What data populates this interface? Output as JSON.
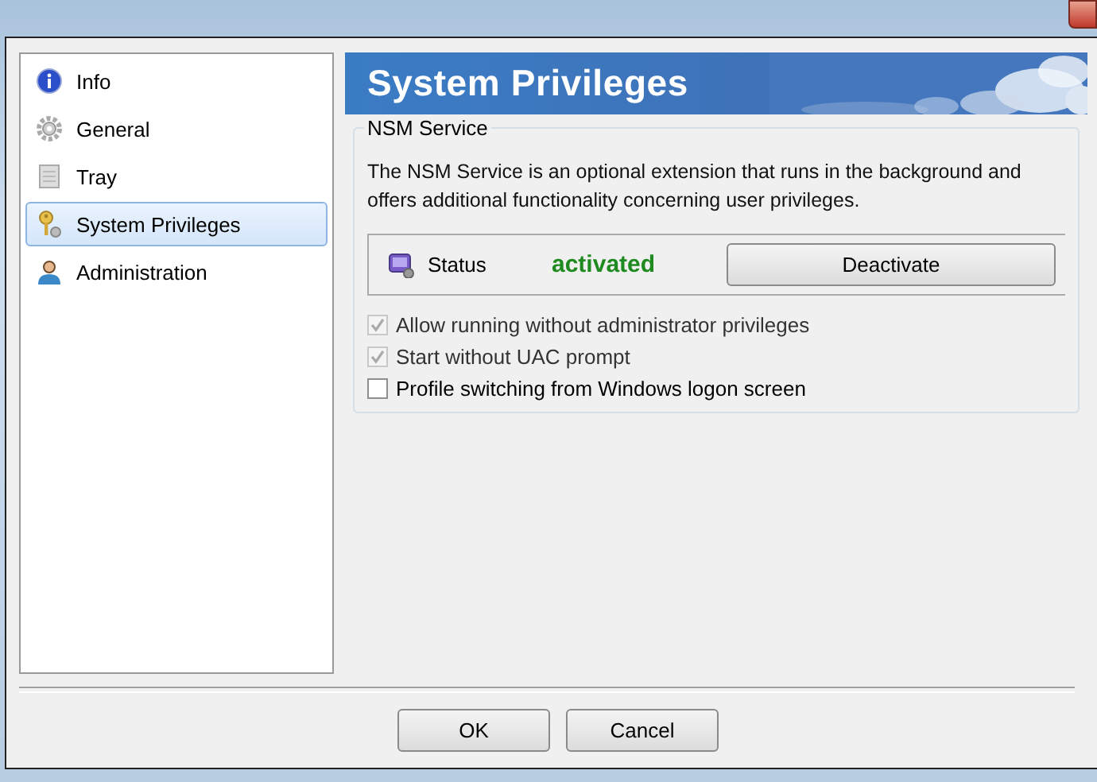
{
  "sidebar": {
    "items": [
      {
        "label": "Info",
        "selected": false
      },
      {
        "label": "General",
        "selected": false
      },
      {
        "label": "Tray",
        "selected": false
      },
      {
        "label": "System Privileges",
        "selected": true
      },
      {
        "label": "Administration",
        "selected": false
      }
    ]
  },
  "header": {
    "title": "System Privileges"
  },
  "group": {
    "title": "NSM Service",
    "description": "The NSM Service is an optional extension that runs in the background and offers additional functionality concerning user privileges.",
    "status_label": "Status",
    "status_value": "activated",
    "status_active": true,
    "action_button": "Deactivate",
    "options": [
      {
        "label": "Allow running without administrator privileges",
        "checked": true,
        "disabled": true
      },
      {
        "label": "Start without UAC prompt",
        "checked": true,
        "disabled": true
      },
      {
        "label": "Profile switching from Windows logon screen",
        "checked": false,
        "disabled": false
      }
    ]
  },
  "buttons": [
    "OK",
    "Cancel"
  ]
}
